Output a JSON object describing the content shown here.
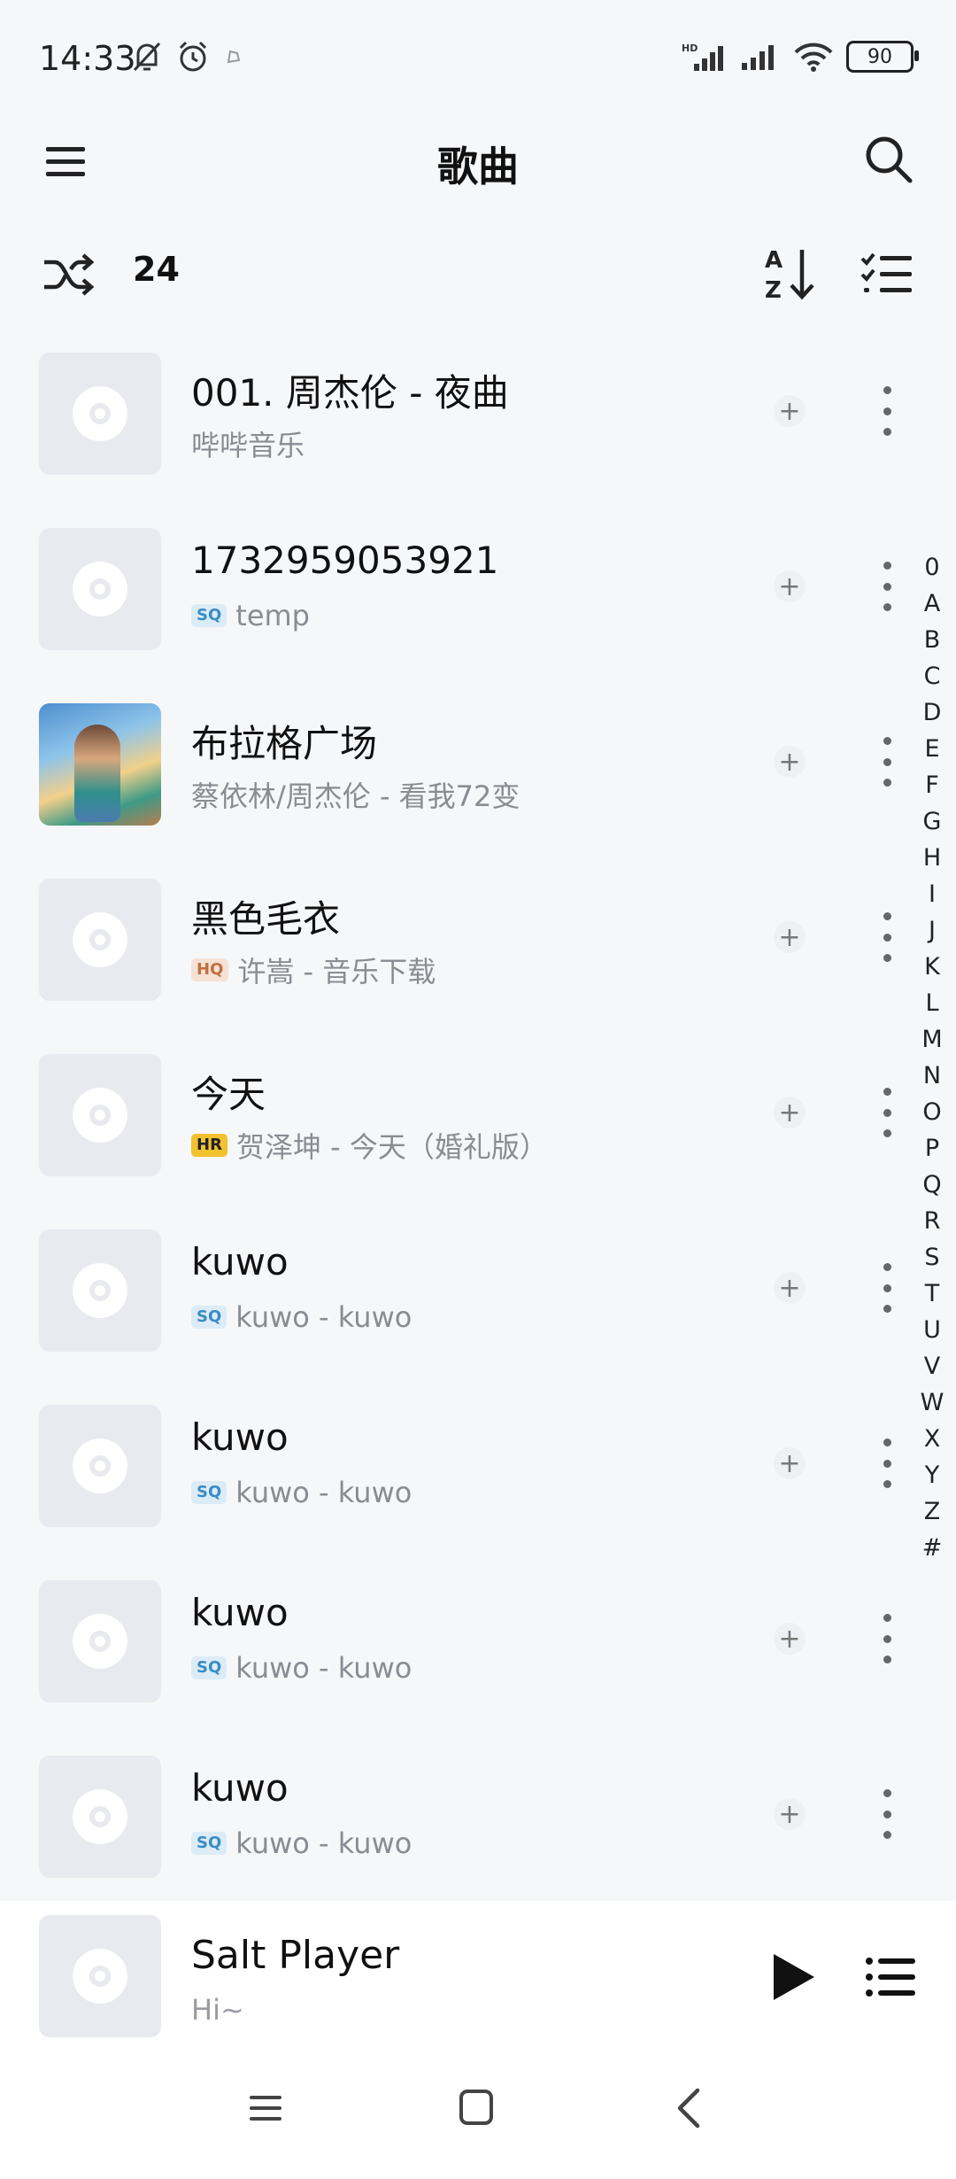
{
  "status_bar": {
    "time": "14:33",
    "battery": "90",
    "network_label": "HD"
  },
  "header": {
    "title": "歌曲"
  },
  "toolbar": {
    "song_count": "24"
  },
  "songs": [
    {
      "title": "001. 周杰伦 - 夜曲",
      "subtitle": "哔哔音乐",
      "badge": "",
      "cover": "placeholder"
    },
    {
      "title": "1732959053921",
      "subtitle": "temp",
      "badge": "SQ",
      "cover": "placeholder"
    },
    {
      "title": "布拉格广场",
      "subtitle": "蔡依林/周杰伦 - 看我72变",
      "badge": "",
      "cover": "album-art"
    },
    {
      "title": "黑色毛衣",
      "subtitle": "许嵩 - 音乐下载",
      "badge": "HQ",
      "cover": "placeholder"
    },
    {
      "title": "今天",
      "subtitle": "贺泽坤 - 今天（婚礼版）",
      "badge": "HR",
      "cover": "placeholder"
    },
    {
      "title": "kuwo",
      "subtitle": "kuwo - kuwo",
      "badge": "SQ",
      "cover": "placeholder"
    },
    {
      "title": "kuwo",
      "subtitle": "kuwo - kuwo",
      "badge": "SQ",
      "cover": "placeholder"
    },
    {
      "title": "kuwo",
      "subtitle": "kuwo - kuwo",
      "badge": "SQ",
      "cover": "placeholder"
    },
    {
      "title": "kuwo",
      "subtitle": "kuwo - kuwo",
      "badge": "SQ",
      "cover": "placeholder"
    }
  ],
  "alpha_index": [
    "0",
    "A",
    "B",
    "C",
    "D",
    "E",
    "F",
    "G",
    "H",
    "I",
    "J",
    "K",
    "L",
    "M",
    "N",
    "O",
    "P",
    "Q",
    "R",
    "S",
    "T",
    "U",
    "V",
    "W",
    "X",
    "Y",
    "Z",
    "#"
  ],
  "mini_player": {
    "title": "Salt Player",
    "subtitle": "Hi~"
  },
  "colors": {
    "background": "#f6f7f9",
    "badge_sq": "#3a8cc4",
    "badge_hq": "#c0703d",
    "badge_hr": "#f2c12e"
  }
}
